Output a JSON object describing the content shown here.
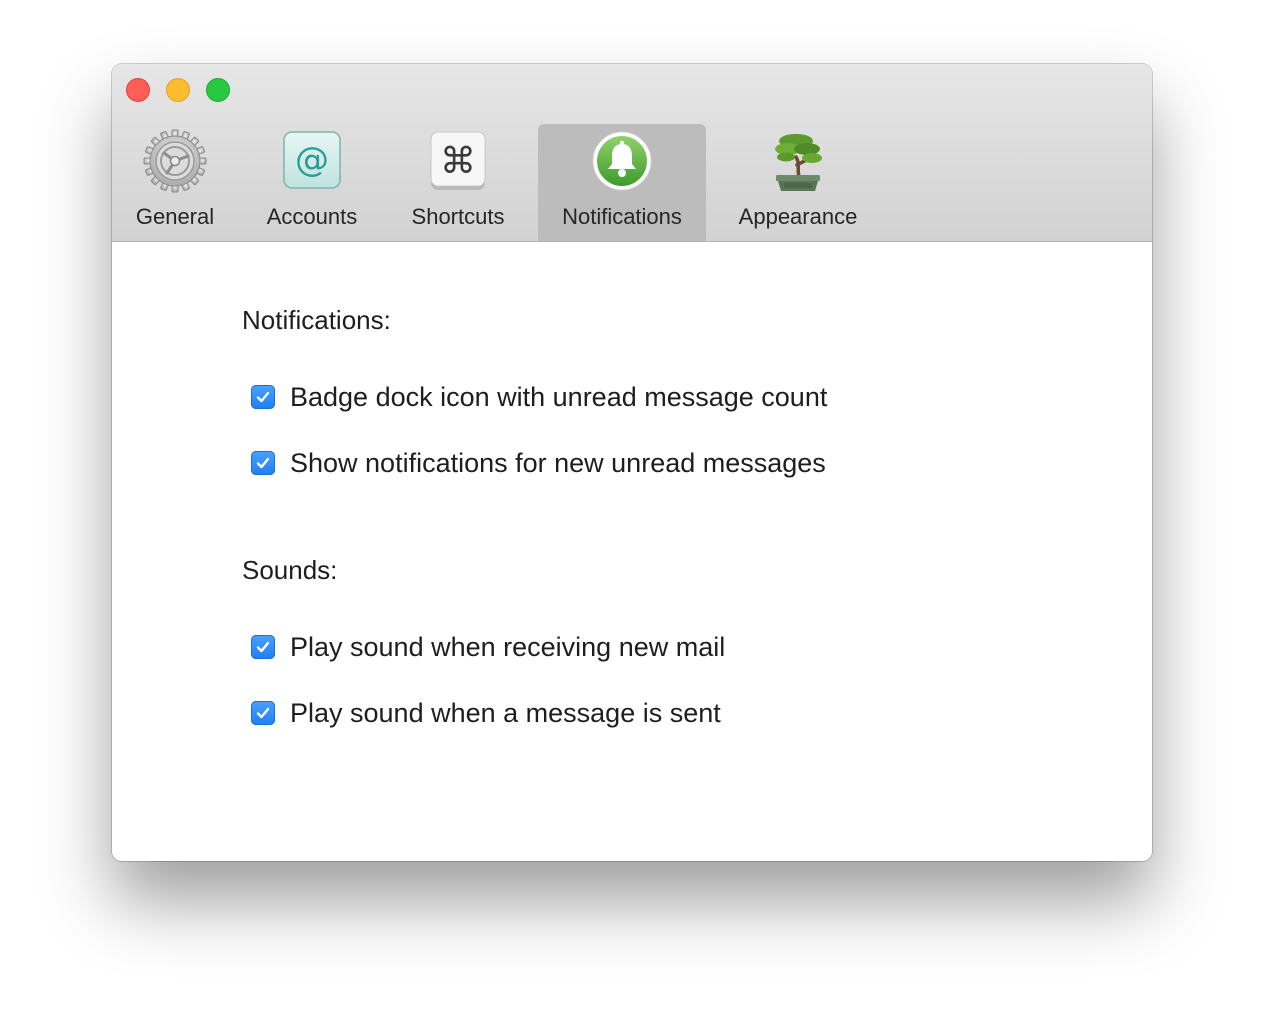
{
  "toolbar": {
    "tabs": [
      {
        "label": "General",
        "icon": "gear-icon",
        "selected": false
      },
      {
        "label": "Accounts",
        "icon": "at-sign-icon",
        "selected": false
      },
      {
        "label": "Shortcuts",
        "icon": "command-key-icon",
        "selected": false
      },
      {
        "label": "Notifications",
        "icon": "bell-icon",
        "selected": true
      },
      {
        "label": "Appearance",
        "icon": "bonsai-tree-icon",
        "selected": false
      }
    ]
  },
  "sections": {
    "notifications": {
      "title": "Notifications:",
      "options": [
        {
          "label": "Badge dock icon with unread message count",
          "checked": true
        },
        {
          "label": "Show notifications for new unread messages",
          "checked": true
        }
      ]
    },
    "sounds": {
      "title": "Sounds:",
      "options": [
        {
          "label": "Play sound when receiving new mail",
          "checked": true
        },
        {
          "label": "Play sound when a message is sent",
          "checked": true
        }
      ]
    }
  },
  "colors": {
    "checkbox_accent": "#2b89fa",
    "close": "#fd5f57",
    "minimize": "#febc2e",
    "maximize": "#28c840",
    "selected_tab": "#bcbcbc"
  }
}
